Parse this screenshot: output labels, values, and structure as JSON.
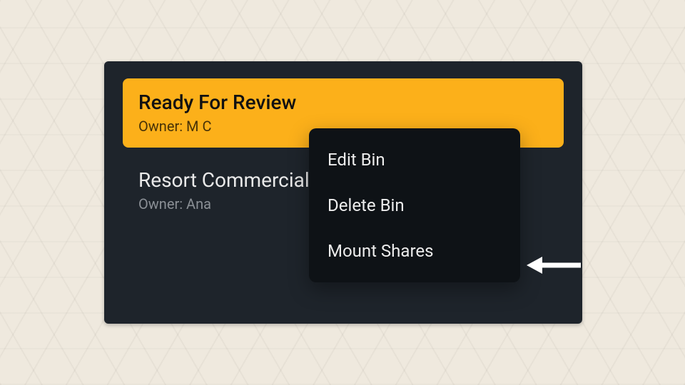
{
  "bins": [
    {
      "title": "Ready For Review",
      "owner": "Owner: M C",
      "selected": true
    },
    {
      "title": "Resort Commercial",
      "owner": "Owner: Ana",
      "selected": false
    }
  ],
  "context_menu": {
    "items": [
      {
        "label": "Edit Bin"
      },
      {
        "label": "Delete Bin"
      },
      {
        "label": "Mount Shares"
      }
    ]
  }
}
